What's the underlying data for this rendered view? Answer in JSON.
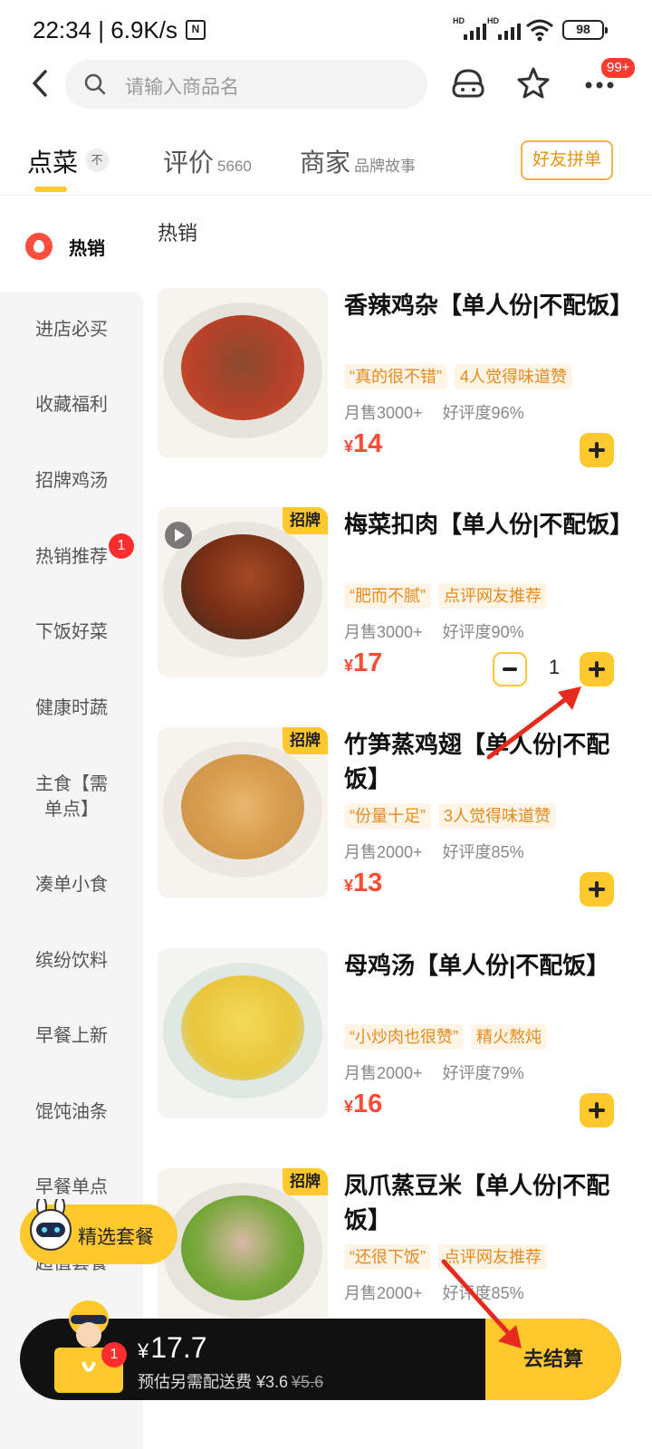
{
  "status_bar": {
    "time": "22:34",
    "speed": "6.9K/s",
    "nfc": "N",
    "signal_1": "HD",
    "signal_2": "HD",
    "battery": "98"
  },
  "header": {
    "search_placeholder": "请输入商品名",
    "more_badge": "99+"
  },
  "tabs": [
    {
      "label": "点菜",
      "sub": ""
    },
    {
      "label": "评价",
      "sub": "5660"
    },
    {
      "label": "商家",
      "sub": "品牌故事"
    }
  ],
  "tab_pin": "不",
  "group_button": "好友拼单",
  "sidebar": {
    "hot": "热销",
    "items": [
      "进店必买",
      "收藏福利",
      "招牌鸡汤",
      "热销推荐",
      "下饭好菜",
      "健康时蔬",
      "主食【需单点】",
      "凑单小食",
      "缤纷饮料",
      "早餐上新",
      "馄饨油条",
      "早餐单点",
      "超值套餐"
    ],
    "hot_recommend_badge": "1"
  },
  "section_title": "热销",
  "colors": {
    "accent": "#ffc82c",
    "price": "#ff4b33",
    "tag_text": "#e8891d"
  },
  "products": [
    {
      "name": "香辣鸡杂【单人份|不配饭】",
      "tags": [
        "“真的很不错”",
        "4人觉得味道赞"
      ],
      "sold": "月售3000+",
      "rating": "好评度96%",
      "currency": "¥",
      "price": "14",
      "signboard": ""
    },
    {
      "name": "梅菜扣肉【单人份|不配饭】",
      "tags": [
        "“肥而不腻”",
        "点评网友推荐"
      ],
      "sold": "月售3000+",
      "rating": "好评度90%",
      "currency": "¥",
      "price": "17",
      "signboard": "招牌",
      "quantity": "1"
    },
    {
      "name": "竹笋蒸鸡翅【单人份|不配饭】",
      "tags": [
        "“份量十足”",
        "3人觉得味道赞"
      ],
      "sold": "月售2000+",
      "rating": "好评度85%",
      "currency": "¥",
      "price": "13",
      "signboard": "招牌"
    },
    {
      "name": "母鸡汤【单人份|不配饭】",
      "tags": [
        "“小炒肉也很赞”",
        "精火熬炖"
      ],
      "sold": "月售2000+",
      "rating": "好评度79%",
      "currency": "¥",
      "price": "16",
      "signboard": ""
    },
    {
      "name": "凤爪蒸豆米【单人份|不配饭】",
      "tags": [
        "“还很下饭”",
        "点评网友推荐"
      ],
      "sold": "月售2000+",
      "rating": "好评度85%",
      "currency": "¥",
      "price": "",
      "signboard": "招牌"
    }
  ],
  "set_meal_button": "精选套餐",
  "checkout": {
    "cart_count": "1",
    "currency": "¥",
    "total": "17.7",
    "fee_label": "预估另需配送费 ¥3.6",
    "fee_original": "¥5.6",
    "go_label": "去结算"
  }
}
